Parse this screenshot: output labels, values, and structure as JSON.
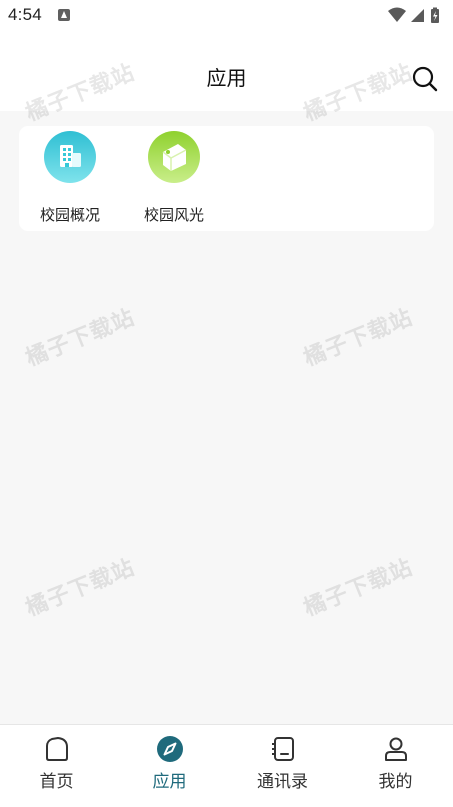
{
  "status_bar": {
    "time": "4:54"
  },
  "header": {
    "title": "应用"
  },
  "apps": [
    {
      "label": "校园概况",
      "icon": "building-icon",
      "color": "#36c9d8"
    },
    {
      "label": "校园风光",
      "icon": "tag-icon",
      "color": "#93d63b"
    }
  ],
  "watermark_text": "橘子下载站",
  "nav": {
    "items": [
      {
        "label": "首页",
        "icon": "home-icon",
        "active": false
      },
      {
        "label": "应用",
        "icon": "compass-icon",
        "active": true
      },
      {
        "label": "通讯录",
        "icon": "contacts-book-icon",
        "active": false
      },
      {
        "label": "我的",
        "icon": "profile-icon",
        "active": false
      }
    ],
    "active_color": "#1f6a7c"
  }
}
